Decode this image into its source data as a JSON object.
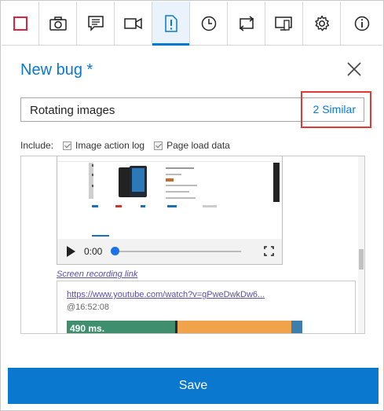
{
  "toolbar": {
    "icons": [
      "stop-recording-icon",
      "camera-icon",
      "note-icon",
      "video-icon",
      "bug-icon",
      "history-icon",
      "sync-icon",
      "screen-icon",
      "gear-icon",
      "info-icon"
    ],
    "active_index": 4,
    "accent": "#0078d4"
  },
  "form": {
    "title": "New bug *",
    "bug_title_value": "Rotating images",
    "similar_label": "2 Similar",
    "include_label": "Include:",
    "include_options": [
      "Image action log",
      "Page load data"
    ]
  },
  "preview": {
    "video_time": "0:00",
    "screen_recording_link": "Screen recording link",
    "youtube_url": "https://www.youtube.com/watch?v=gPweDwkDw6...",
    "timestamp": "@16:52:08",
    "load_bar_label": "490 ms."
  },
  "actions": {
    "save_label": "Save"
  },
  "colors": {
    "primary": "#0b78d0",
    "highlight": "#e03a33",
    "bar_green": "#3f8f6e",
    "bar_orange": "#f0a34a",
    "bar_blue": "#3a7fb0"
  }
}
